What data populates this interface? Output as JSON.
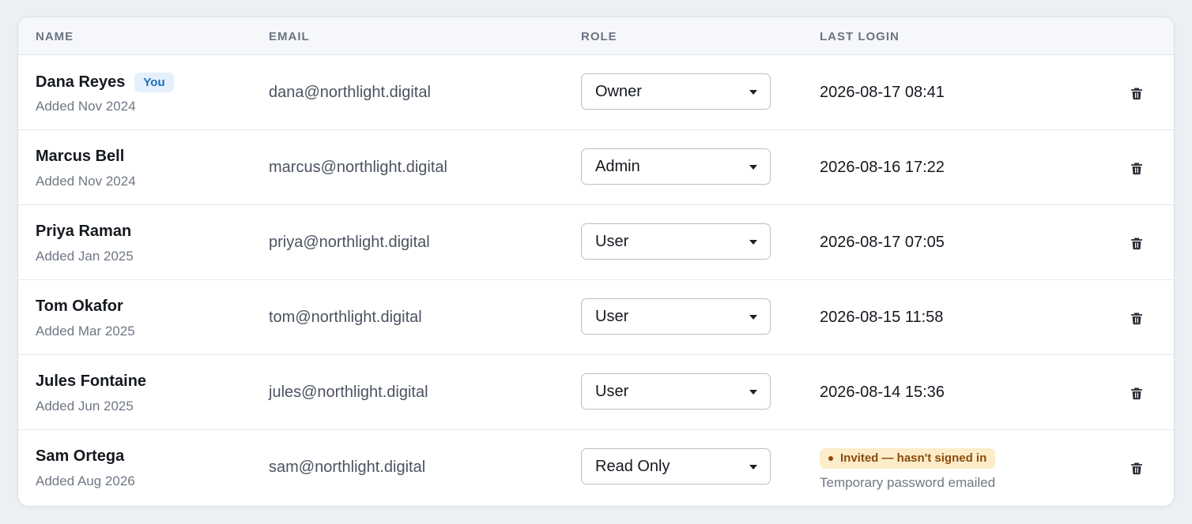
{
  "headers": {
    "name": "NAME",
    "email": "EMAIL",
    "role": "ROLE",
    "last_login": "LAST LOGIN"
  },
  "users": [
    {
      "name": "Dana Reyes",
      "badge": "You",
      "added": "Added Nov 2024",
      "email": "dana@northlight.digital",
      "role": "Owner",
      "last_login": "2026-08-17 08:41"
    },
    {
      "name": "Marcus Bell",
      "added": "Added Nov 2024",
      "email": "marcus@northlight.digital",
      "role": "Admin",
      "last_login": "2026-08-16 17:22"
    },
    {
      "name": "Priya Raman",
      "added": "Added Jan 2025",
      "email": "priya@northlight.digital",
      "role": "User",
      "last_login": "2026-08-17 07:05"
    },
    {
      "name": "Tom Okafor",
      "added": "Added Mar 2025",
      "email": "tom@northlight.digital",
      "role": "User",
      "last_login": "2026-08-15 11:58"
    },
    {
      "name": "Jules Fontaine",
      "added": "Added Jun 2025",
      "email": "jules@northlight.digital",
      "role": "User",
      "last_login": "2026-08-14 15:36"
    },
    {
      "name": "Sam Ortega",
      "added": "Added Aug 2026",
      "email": "sam@northlight.digital",
      "role": "Read Only",
      "status": "Invited — hasn't signed in",
      "status_detail": "Temporary password emailed"
    }
  ],
  "icons": {
    "delete": "trash-icon",
    "dropdown": "chevron-down-icon",
    "status": "dot-icon"
  },
  "colors": {
    "you_badge_bg": "#e4f0fb",
    "you_badge_text": "#1b6fb8",
    "invite_badge_bg": "#fcecc9",
    "invite_badge_text": "#8a4b0c"
  }
}
